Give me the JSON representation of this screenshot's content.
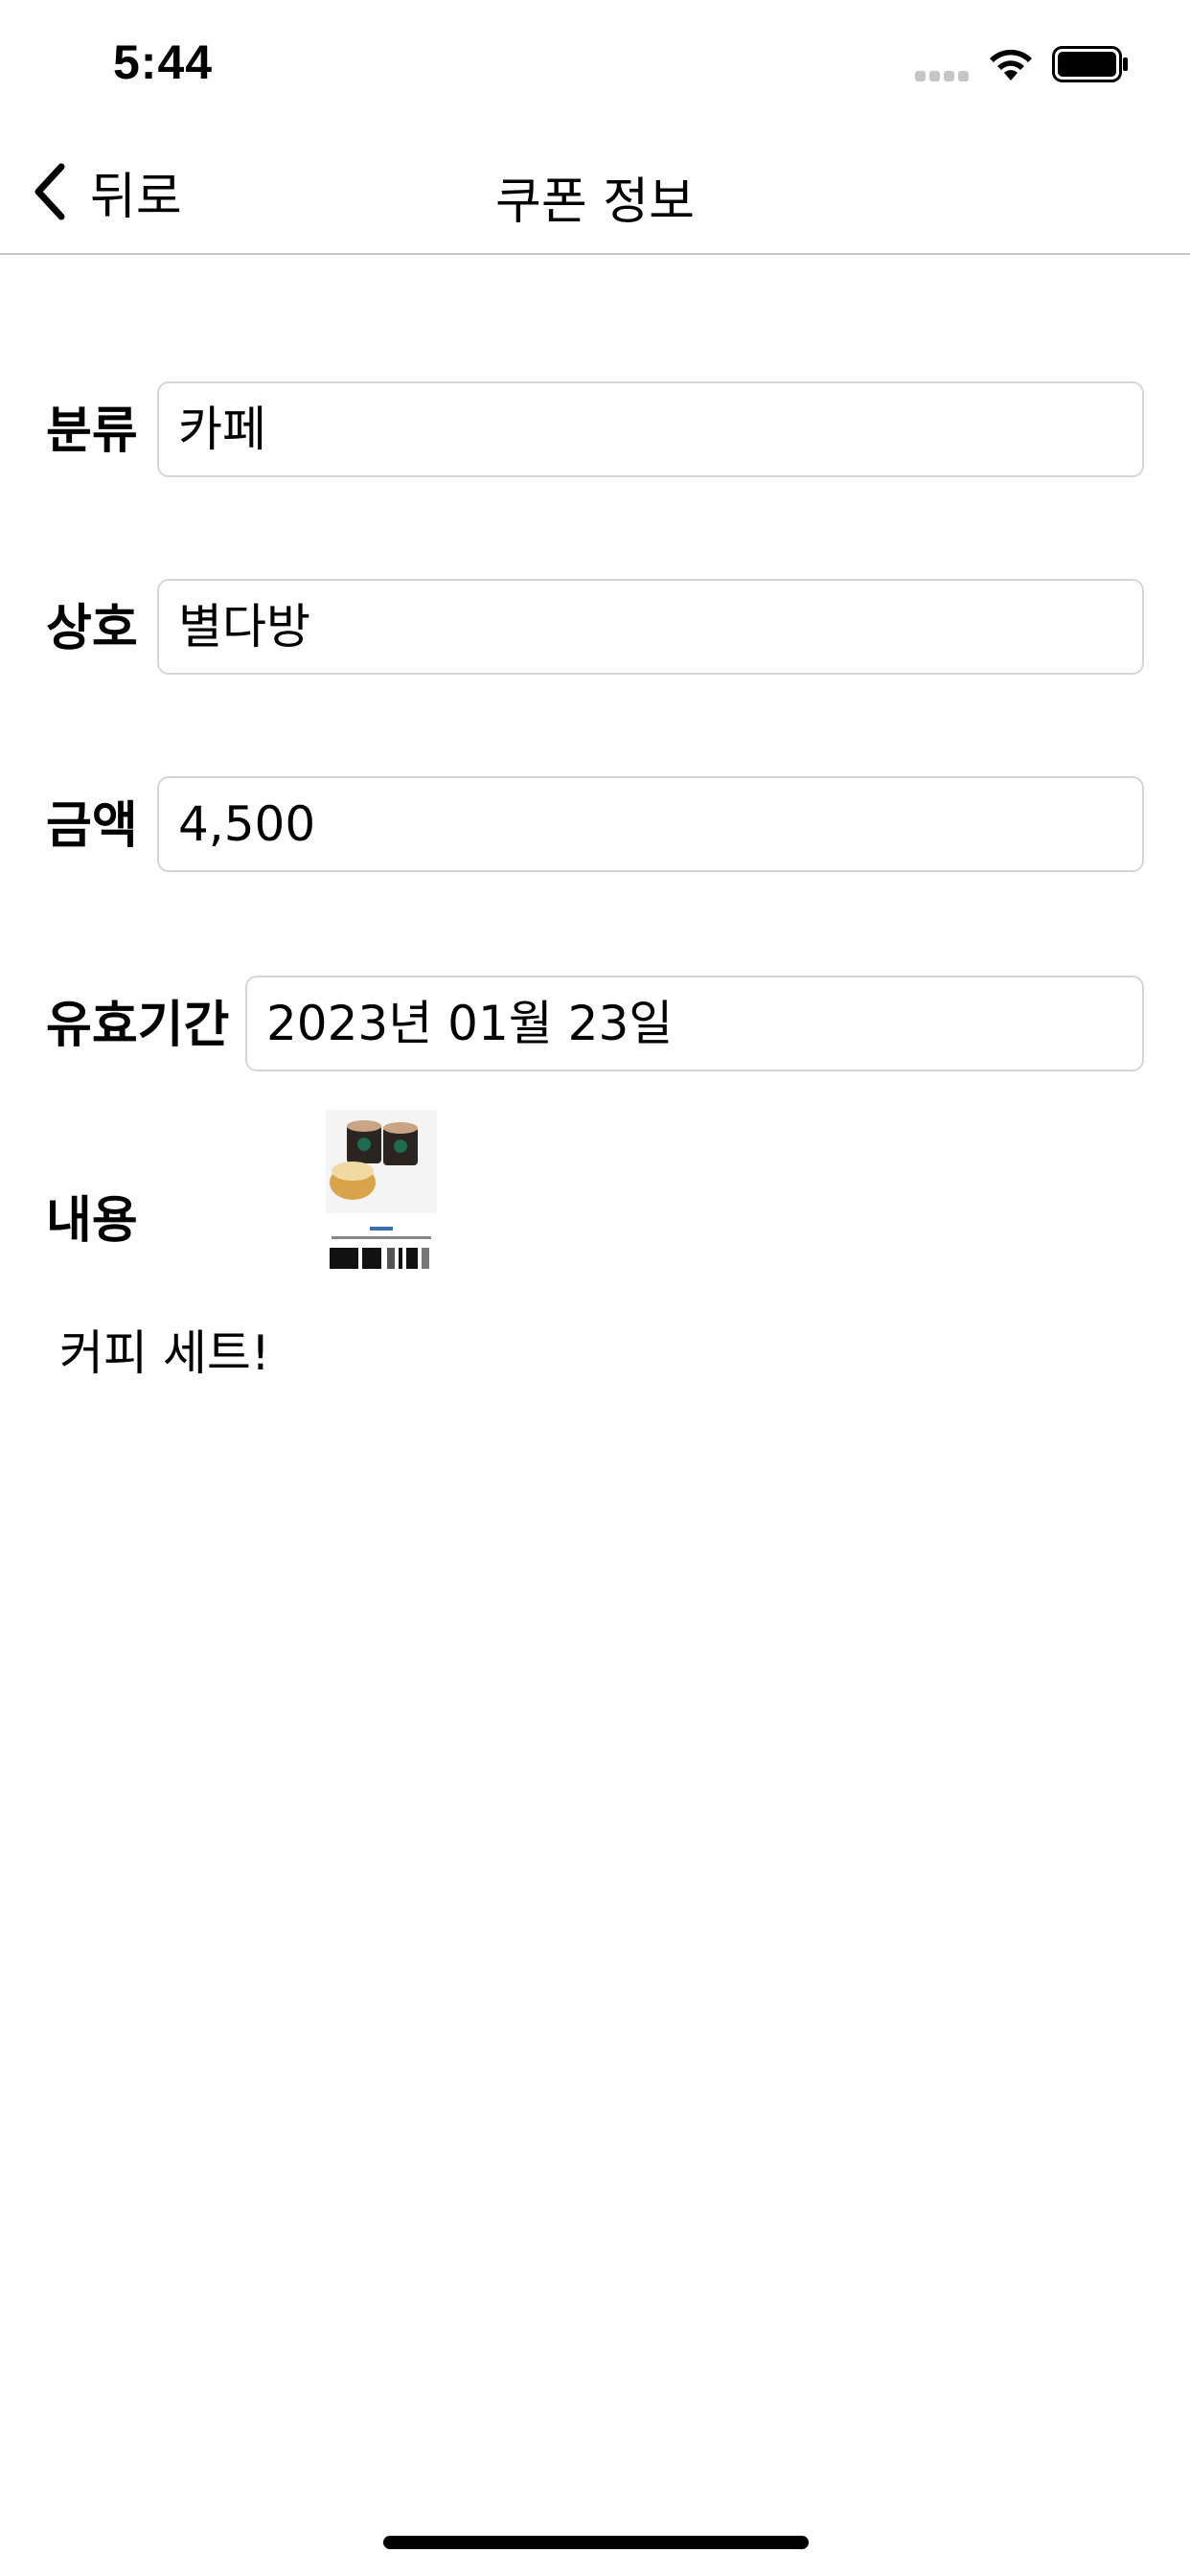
{
  "status_bar": {
    "time": "5:44"
  },
  "nav": {
    "back_label": "뒤로",
    "title": "쿠폰 정보"
  },
  "form": {
    "category": {
      "label": "분류",
      "value": "카페"
    },
    "store": {
      "label": "상호",
      "value": "별다방"
    },
    "amount": {
      "label": "금액",
      "value": "4,500"
    },
    "expiry": {
      "label": "유효기간",
      "value": "2023년 01월 23일"
    },
    "content": {
      "label": "내용",
      "text": "커피 세트!"
    }
  },
  "icons": {
    "back": "chevron-left-icon",
    "wifi": "wifi-icon",
    "battery": "battery-icon",
    "signal": "signal-dots-icon"
  },
  "colors": {
    "field_border": "#d6d6d8",
    "separator": "#c8c8cc",
    "text": "#000000"
  }
}
